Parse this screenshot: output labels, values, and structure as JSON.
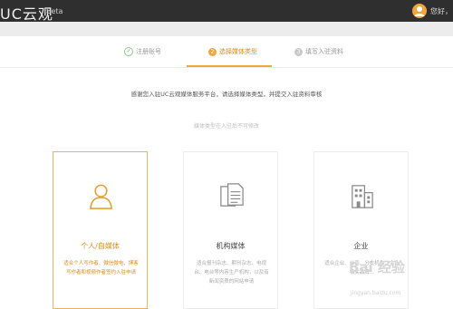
{
  "header": {
    "brand": "UC云观",
    "beta": "Beta",
    "user": "您好，"
  },
  "steps": [
    {
      "num": "✓",
      "label": "注册账号"
    },
    {
      "num": "2",
      "label": "选择媒体类型"
    },
    {
      "num": "3",
      "label": "填写入驻资料"
    }
  ],
  "intro": "感谢您入驻UC云观媒体服务平台，请选择媒体类型，并提交入驻资料审核",
  "note": "媒体类型在入驻后不可修改",
  "cards": [
    {
      "title": "个人/自媒体",
      "desc": "适合个人写作者、微信微电、博客写作者和视频作者签约入驻申请"
    },
    {
      "title": "机构媒体",
      "desc": "适合报刊杂志、期刊杂志、电视台、电台等内容生产机构，以及有新闻资质的网站申请"
    },
    {
      "title": "企业",
      "desc": "适合企业、公司、分支机构、企业相关品牌…"
    }
  ],
  "watermark": {
    "logo": "Bai 经验",
    "url": "jingyan.baidu.com"
  },
  "colors": {
    "accent": "#f0a63e",
    "topbar": "#2f2f2f",
    "success": "#5aa05a"
  }
}
